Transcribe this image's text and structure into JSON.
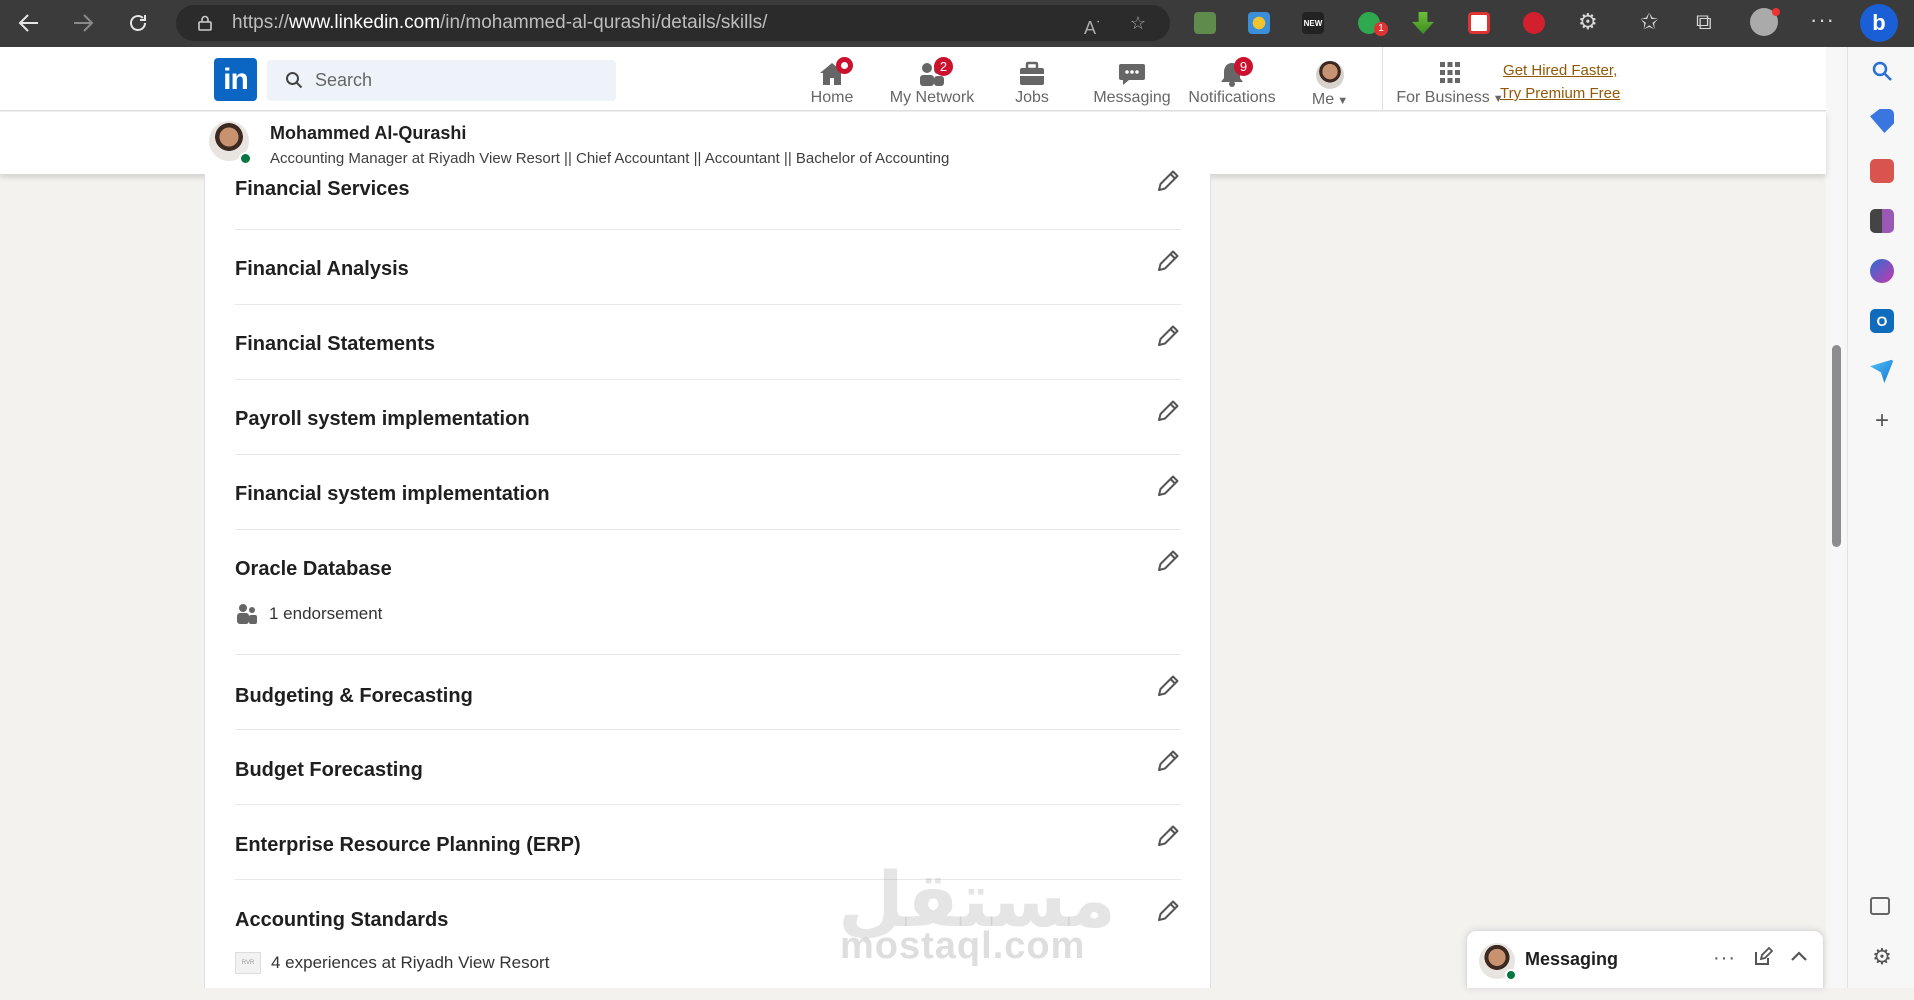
{
  "browser": {
    "url_prefix": "https://",
    "url_host": "www.linkedin.com",
    "url_path": "/in/mohammed-al-qurashi/details/skills/",
    "back_icon": "arrow-left-icon",
    "forward_icon": "arrow-right-icon",
    "reload_icon": "reload-icon",
    "ext_new_label": "NEW",
    "ext_badge": "1"
  },
  "header": {
    "logo": "in",
    "search_placeholder": "Search",
    "nav": [
      {
        "label": "Home",
        "badge": ""
      },
      {
        "label": "My Network",
        "badge": "2"
      },
      {
        "label": "Jobs",
        "badge": ""
      },
      {
        "label": "Messaging",
        "badge": ""
      },
      {
        "label": "Notifications",
        "badge": "9"
      },
      {
        "label": "Me",
        "badge": ""
      },
      {
        "label": "For Business",
        "badge": ""
      }
    ],
    "premium_line1": "Get Hired Faster,",
    "premium_line2": "Try Premium Free"
  },
  "profile": {
    "name": "Mohammed Al-Qurashi",
    "headline": "Accounting Manager at Riyadh View Resort || Chief Accountant || Accountant || Bachelor of Accounting"
  },
  "skills": [
    {
      "name": "Financial Services"
    },
    {
      "name": "Financial Analysis"
    },
    {
      "name": "Financial Statements"
    },
    {
      "name": "Payroll system implementation"
    },
    {
      "name": "Financial system implementation"
    },
    {
      "name": "Oracle Database",
      "detail": "1 endorsement"
    },
    {
      "name": "Budgeting & Forecasting"
    },
    {
      "name": "Budget Forecasting"
    },
    {
      "name": "Enterprise Resource Planning (ERP)"
    },
    {
      "name": "Accounting Standards",
      "detail": "4 experiences at Riyadh View Resort"
    }
  ],
  "watermark": {
    "arabic": "مستقل",
    "latin": "mostaql.com"
  },
  "messaging": {
    "label": "Messaging"
  },
  "colors": {
    "brand": "#0a66c2",
    "badge": "#cb112d",
    "online": "#057642",
    "premium": "#915907"
  }
}
